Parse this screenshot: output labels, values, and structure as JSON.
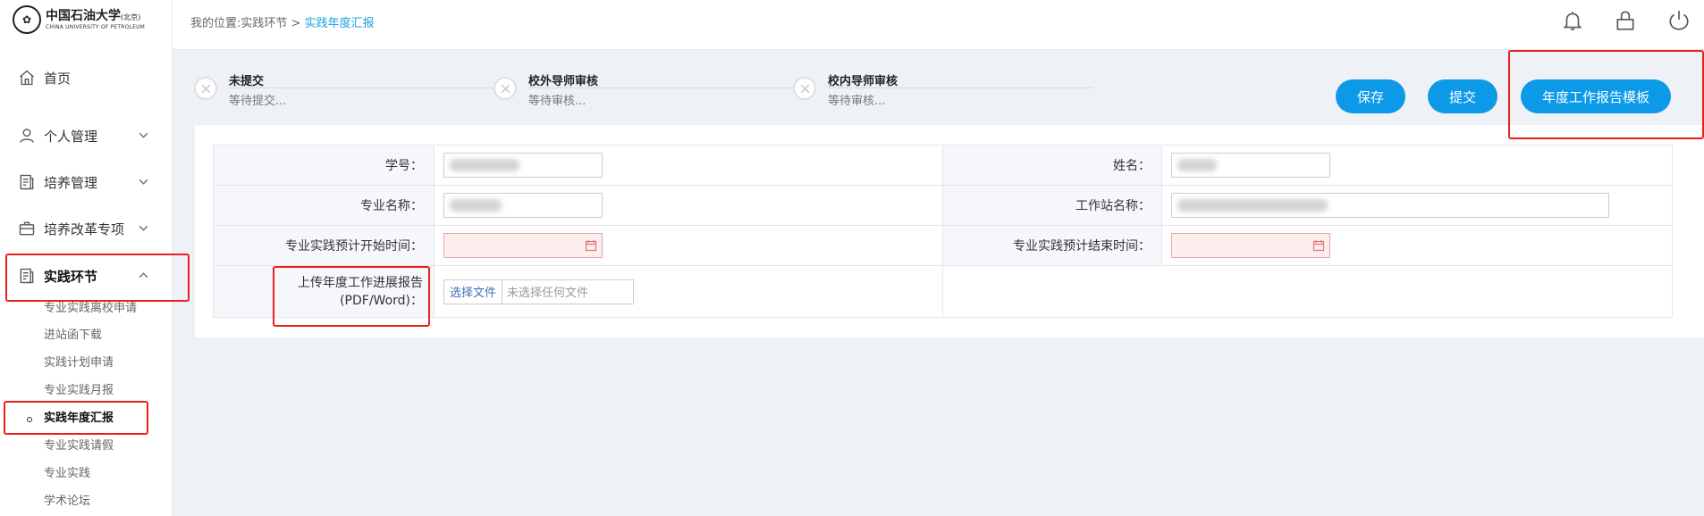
{
  "logo": {
    "cn_name": "中国石油大学",
    "cn_suffix": "(北京)",
    "en_name": "CHINA UNIVERSITY OF PETROLEUM"
  },
  "breadcrumb": {
    "prefix": "我的位置:",
    "parent": "实践环节",
    "separator": " > ",
    "current": "实践年度汇报"
  },
  "sidebar": {
    "items": [
      {
        "label": "首页",
        "icon": "home-icon"
      },
      {
        "label": "个人管理",
        "icon": "user-icon"
      },
      {
        "label": "培养管理",
        "icon": "document-icon"
      },
      {
        "label": "培养改革专项",
        "icon": "briefcase-icon"
      },
      {
        "label": "实践环节",
        "icon": "document-icon",
        "expanded": true
      }
    ],
    "subitems": [
      {
        "label": "专业实践离校申请"
      },
      {
        "label": "进站函下载"
      },
      {
        "label": "实践计划申请"
      },
      {
        "label": "专业实践月报"
      },
      {
        "label": "实践年度汇报",
        "active": true
      },
      {
        "label": "专业实践请假"
      },
      {
        "label": "专业实践"
      },
      {
        "label": "学术论坛"
      }
    ]
  },
  "top_icons": [
    "bell-icon",
    "lock-icon",
    "power-icon"
  ],
  "steps": [
    {
      "title": "未提交",
      "desc": "等待提交..."
    },
    {
      "title": "校外导师审核",
      "desc": "等待审核..."
    },
    {
      "title": "校内导师审核",
      "desc": "等待审核..."
    }
  ],
  "actions": {
    "save": "保存",
    "submit": "提交",
    "template": "年度工作报告模板"
  },
  "form": {
    "student_id_label": "学号：",
    "name_label": "姓名：",
    "major_label": "专业名称：",
    "station_label": "工作站名称：",
    "start_label": "专业实践预计开始时间：",
    "end_label": "专业实践预计结束时间：",
    "upload_label_line1": "上传年度工作进展报告",
    "upload_label_line2": "(PDF/Word)：",
    "file_button": "选择文件",
    "file_placeholder": "未选择任何文件"
  },
  "colors": {
    "accent": "#0c9ae8",
    "highlight": "#e8201e",
    "breadcrumb_current": "#1a9fe0",
    "invalid_field": "#fdeeee"
  }
}
